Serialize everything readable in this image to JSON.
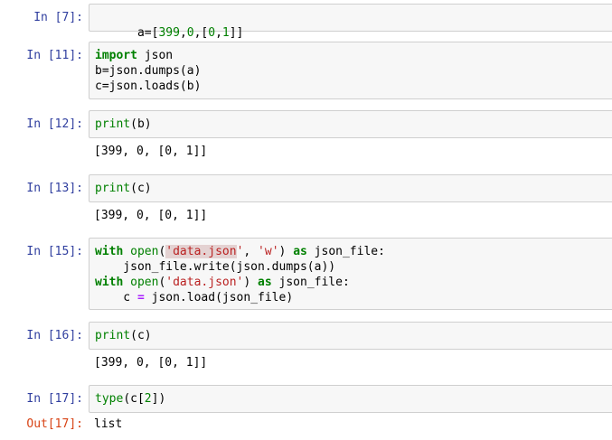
{
  "cells": [
    {
      "prompt": "In [7]:",
      "code": [
        "a=[399,0,[0,1]]"
      ]
    },
    {
      "prompt": "In [11]:",
      "code": [
        "import json",
        "b=json.dumps(a)",
        "c=json.loads(b)"
      ]
    },
    {
      "prompt": "In [12]:",
      "code": [
        "print(b)"
      ],
      "output": "[399, 0, [0, 1]]"
    },
    {
      "prompt": "In [13]:",
      "code": [
        "print(c)"
      ],
      "output": "[399, 0, [0, 1]]"
    },
    {
      "prompt": "In [15]:",
      "code": [
        "with open('data.json', 'w') as json_file:",
        "    json_file.write(json.dumps(a))",
        "with open('data.json') as json_file:",
        "    c = json.load(json_file)"
      ]
    },
    {
      "prompt": "In [16]:",
      "code": [
        "print(c)"
      ],
      "output": "[399, 0, [0, 1]]"
    },
    {
      "prompt": "In [17]:",
      "code": [
        "type(c[2])"
      ],
      "out_prompt": "Out[17]:",
      "output": "list"
    }
  ]
}
